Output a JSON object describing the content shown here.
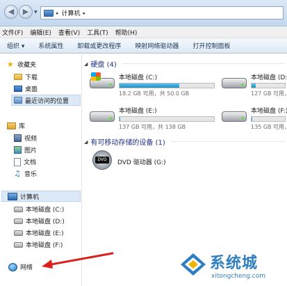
{
  "address_bar": {
    "path_root_glyph": "▸",
    "path_item": "计算机",
    "path_separator": "▸"
  },
  "menu": [
    "文件(F)",
    "编辑(E)",
    "查看(V)",
    "工具(T)",
    "帮助(H)"
  ],
  "toolbar": {
    "organize": "组织 ▾",
    "system_properties": "系统属性",
    "uninstall": "卸载或更改程序",
    "map_drive": "映射网络驱动器",
    "control_panel": "打开控制面板"
  },
  "nav": {
    "favorites": {
      "label": "收藏夹",
      "items": [
        "下载",
        "桌面",
        "最近访问的位置"
      ]
    },
    "libraries": {
      "label": "库",
      "items": [
        "视频",
        "图片",
        "文档",
        "音乐"
      ]
    },
    "computer": {
      "label": "计算机",
      "items": [
        "本地磁盘 (C:)",
        "本地磁盘 (D:)",
        "本地磁盘 (E:)",
        "本地磁盘 (F:)"
      ]
    },
    "network": {
      "label": "网络"
    }
  },
  "content": {
    "hard_disks_header": "硬盘 (4)",
    "drives": [
      {
        "name": "本地磁盘 (C:)",
        "free_text": "18.2 GB 可用，共 50.0 GB",
        "used_fraction": 0.636
      },
      {
        "name": "本地磁盘 (D:)",
        "free_text": "127 GB 可用，共",
        "used_fraction": 0.12
      },
      {
        "name": "本地磁盘 (E:)",
        "free_text": "137 GB 可用，共 138 GB",
        "used_fraction": 0.01
      },
      {
        "name": "本地磁盘 (F:)",
        "free_text": "135 GB 可用，共",
        "used_fraction": 0.02
      }
    ],
    "removable_header": "有可移动存储的设备 (1)",
    "dvd": {
      "badge": "DVD",
      "name": "DVD 驱动器 (G:)"
    }
  },
  "watermark": {
    "brand": "系统城",
    "url": "xitongcheng.com"
  },
  "colors": {
    "accent": "#1e3287",
    "usage_bar": "#1f8fc7",
    "arrow": "#d8201c",
    "watermark": "#2d7fc1"
  }
}
